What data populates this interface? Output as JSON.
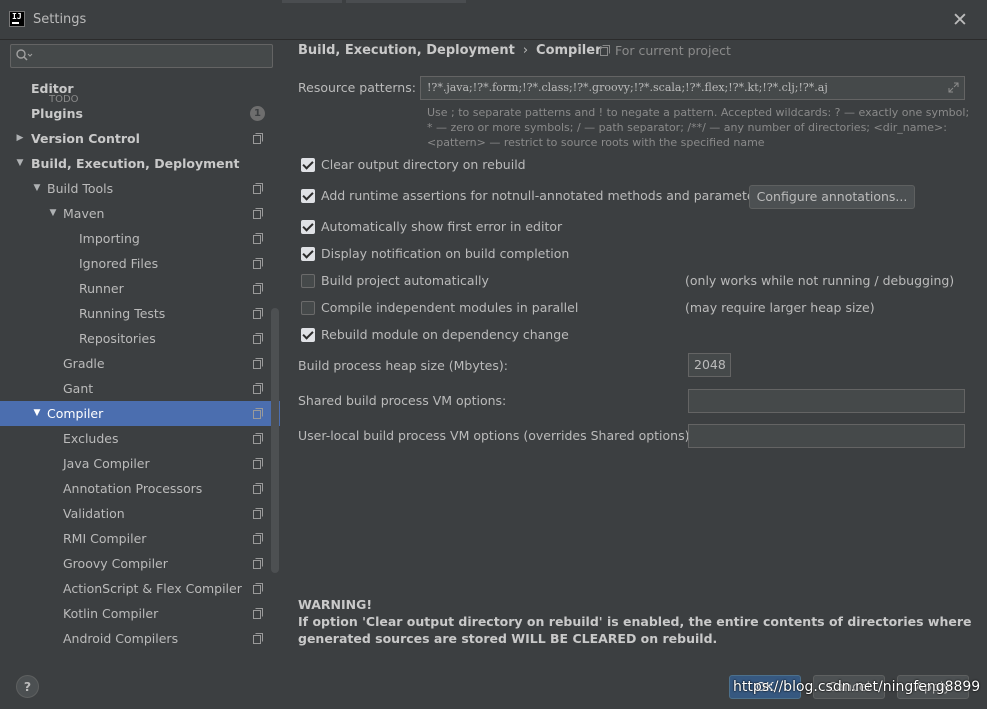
{
  "window": {
    "title": "Settings",
    "logo_text": "IJ"
  },
  "search": {
    "placeholder": ""
  },
  "sidebar": {
    "peek_text": "TODO",
    "items": [
      {
        "label": "Editor",
        "indent": 0,
        "arrow": "",
        "bold": true,
        "icon": ""
      },
      {
        "label": "Plugins",
        "indent": 0,
        "arrow": "",
        "bold": true,
        "badge": "1"
      },
      {
        "label": "Version Control",
        "indent": 0,
        "arrow": "collapsed",
        "bold": true,
        "icon": "project-icon"
      },
      {
        "label": "Build, Execution, Deployment",
        "indent": 0,
        "arrow": "expanded",
        "bold": true,
        "icon": ""
      },
      {
        "label": "Build Tools",
        "indent": 1,
        "arrow": "expanded",
        "icon": "project-icon"
      },
      {
        "label": "Maven",
        "indent": 2,
        "arrow": "expanded",
        "icon": "project-icon"
      },
      {
        "label": "Importing",
        "indent": 3,
        "arrow": "",
        "icon": "project-icon"
      },
      {
        "label": "Ignored Files",
        "indent": 3,
        "arrow": "",
        "icon": "project-icon"
      },
      {
        "label": "Runner",
        "indent": 3,
        "arrow": "",
        "icon": "project-icon"
      },
      {
        "label": "Running Tests",
        "indent": 3,
        "arrow": "",
        "icon": "project-icon"
      },
      {
        "label": "Repositories",
        "indent": 3,
        "arrow": "",
        "icon": "project-icon"
      },
      {
        "label": "Gradle",
        "indent": 2,
        "arrow": "",
        "icon": "project-icon"
      },
      {
        "label": "Gant",
        "indent": 2,
        "arrow": "",
        "icon": "project-icon"
      },
      {
        "label": "Compiler",
        "indent": 1,
        "arrow": "expanded",
        "icon": "project-icon",
        "selected": true
      },
      {
        "label": "Excludes",
        "indent": 2,
        "arrow": "",
        "icon": "project-icon"
      },
      {
        "label": "Java Compiler",
        "indent": 2,
        "arrow": "",
        "icon": "project-icon"
      },
      {
        "label": "Annotation Processors",
        "indent": 2,
        "arrow": "",
        "icon": "project-icon"
      },
      {
        "label": "Validation",
        "indent": 2,
        "arrow": "",
        "icon": "project-icon"
      },
      {
        "label": "RMI Compiler",
        "indent": 2,
        "arrow": "",
        "icon": "project-icon"
      },
      {
        "label": "Groovy Compiler",
        "indent": 2,
        "arrow": "",
        "icon": "project-icon"
      },
      {
        "label": "ActionScript & Flex Compiler",
        "indent": 2,
        "arrow": "",
        "icon": "project-icon"
      },
      {
        "label": "Kotlin Compiler",
        "indent": 2,
        "arrow": "",
        "icon": "project-icon"
      },
      {
        "label": "Android Compilers",
        "indent": 2,
        "arrow": "",
        "icon": "project-icon"
      }
    ]
  },
  "main": {
    "breadcrumb": {
      "parent": "Build, Execution, Deployment",
      "separator": "›",
      "current": "Compiler"
    },
    "for_project": "For current project",
    "resource_patterns": {
      "label": "Resource patterns:",
      "value": "!?*.java;!?*.form;!?*.class;!?*.groovy;!?*.scala;!?*.flex;!?*.kt;!?*.clj;!?*.aj",
      "help": "Use ; to separate patterns and ! to negate a pattern. Accepted wildcards: ? — exactly one symbol; * — zero or more symbols; / — path separator; /**/ — any number of directories; <dir_name>:<pattern> — restrict to source roots with the specified name"
    },
    "options": [
      {
        "label": "Clear output directory on rebuild",
        "checked": true,
        "note": ""
      },
      {
        "label": "Add runtime assertions for notnull-annotated methods and parameters",
        "checked": true,
        "note": ""
      },
      {
        "label": "Automatically show first error in editor",
        "checked": true,
        "note": ""
      },
      {
        "label": "Display notification on build completion",
        "checked": true,
        "note": ""
      },
      {
        "label": "Build project automatically",
        "checked": false,
        "note": "(only works while not running / debugging)"
      },
      {
        "label": "Compile independent modules in parallel",
        "checked": false,
        "note": "(may require larger heap size)"
      },
      {
        "label": "Rebuild module on dependency change",
        "checked": true,
        "note": ""
      }
    ],
    "configure_button": "Configure annotations...",
    "heap": {
      "label": "Build process heap size (Mbytes):",
      "value": "2048"
    },
    "shared_vm": {
      "label": "Shared build process VM options:",
      "value": ""
    },
    "user_vm": {
      "label": "User-local build process VM options (overrides Shared options):",
      "value": ""
    },
    "warning": {
      "title": "WARNING!",
      "text": "If option 'Clear output directory on rebuild' is enabled, the entire contents of directories where generated sources are stored WILL BE CLEARED on rebuild."
    }
  },
  "footer": {
    "help": "?",
    "ok": "OK",
    "cancel": "Cancel",
    "apply": "Apply",
    "watermark": "https://blog.csdn.net/ningfeng8899"
  },
  "colors": {
    "background": "#3c3f41",
    "selection": "#4b6eaf",
    "field": "#45494a",
    "ok_button": "#365880"
  }
}
